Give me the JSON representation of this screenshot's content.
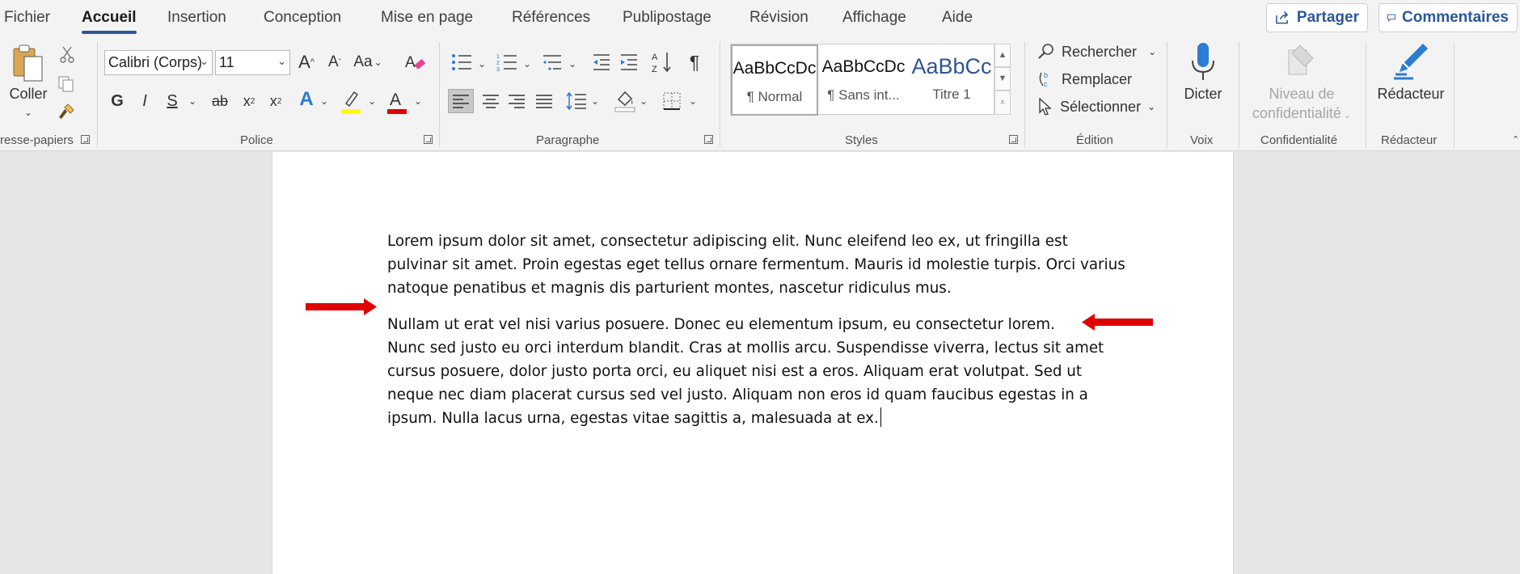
{
  "menu": {
    "tabs": [
      "Fichier",
      "Accueil",
      "Insertion",
      "Conception",
      "Mise en page",
      "Références",
      "Publipostage",
      "Révision",
      "Affichage",
      "Aide"
    ],
    "share_label": "Partager",
    "comments_label": "Commentaires"
  },
  "ribbon": {
    "clipboard": {
      "paste_label": "Coller",
      "group_label": "resse-papiers"
    },
    "font": {
      "name": "Calibri (Corps)",
      "size": "11",
      "change_case": "Aa",
      "bold": "G",
      "italic": "I",
      "underline": "S",
      "strike": "ab",
      "subscript": "x",
      "superscript": "x",
      "group_label": "Police"
    },
    "paragraph": {
      "pilcrow": "¶",
      "group_label": "Paragraphe"
    },
    "styles": {
      "items": [
        {
          "preview": "AaBbCcDc",
          "name": "¶ Normal",
          "color": "#111111"
        },
        {
          "preview": "AaBbCcDc",
          "name": "¶ Sans int...",
          "color": "#111111"
        },
        {
          "preview": "AaBbCc",
          "name": "Titre 1",
          "color": "#2f5496"
        }
      ],
      "group_label": "Styles"
    },
    "editing": {
      "find_label": "Rechercher",
      "replace_label": "Remplacer",
      "select_label": "Sélectionner",
      "group_label": "Édition"
    },
    "voice": {
      "dictate_label": "Dicter",
      "group_label": "Voix"
    },
    "sensitivity": {
      "label_line1": "Niveau de",
      "label_line2": "confidentialité",
      "group_label": "Confidentialité"
    },
    "editor": {
      "label": "Rédacteur",
      "group_label": "Rédacteur"
    }
  },
  "document": {
    "paragraph1": "Lorem ipsum dolor sit amet, consectetur adipiscing elit. Nunc eleifend leo ex, ut fringilla est pulvinar sit amet. Proin egestas eget tellus ornare fermentum. Mauris id molestie turpis. Orci varius natoque penatibus et magnis dis parturient montes, nascetur ridiculus mus.",
    "paragraph2_line1": "Nullam ut erat vel nisi varius posuere. Donec eu elementum ipsum, eu consectetur lorem.",
    "paragraph2_rest": "Nunc sed justo eu orci interdum blandit. Cras at mollis arcu. Suspendisse viverra, lectus sit amet cursus posuere, dolor justo porta orci, eu aliquet nisi est a eros. Aliquam erat volutpat. Sed ut neque nec diam placerat cursus sed vel justo. Aliquam non eros id quam faucibus egestas in a ipsum. Nulla lacus urna, egestas vitae sagittis a, malesuada at ex.",
    "annotation_color": "#e00000"
  },
  "colors": {
    "accent": "#2b579a",
    "highlight": "#ffff00",
    "font_color": "#e00000"
  }
}
